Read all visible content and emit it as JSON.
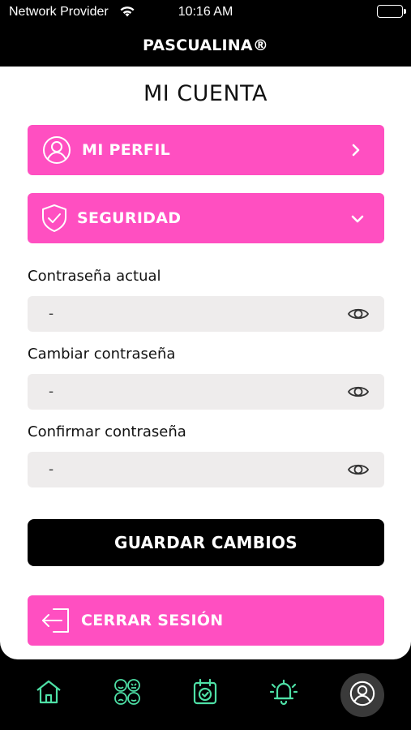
{
  "status_bar": {
    "carrier": "Network Provider",
    "time": "10:16 AM",
    "icons": [
      "wifi-icon",
      "battery-icon"
    ]
  },
  "header": {
    "title": "PASCUALINA®"
  },
  "page": {
    "title": "MI CUENTA"
  },
  "sections": {
    "profile": {
      "label": "MI PERFIL",
      "icon": "user-circle-icon",
      "chevron": "chevron-right-icon"
    },
    "security": {
      "label": "SEGURIDAD",
      "icon": "shield-check-icon",
      "chevron": "chevron-down-icon",
      "expanded": true
    }
  },
  "fields": [
    {
      "label": "Contraseña actual",
      "value": "-",
      "icon": "eye-icon"
    },
    {
      "label": "Cambiar contraseña",
      "value": "-",
      "icon": "eye-icon"
    },
    {
      "label": "Confirmar contraseña",
      "value": "-",
      "icon": "eye-icon"
    }
  ],
  "buttons": {
    "save": "GUARDAR CAMBIOS",
    "logout": {
      "label": "CERRAR SESIÓN",
      "icon": "logout-icon"
    }
  },
  "tab_bar": {
    "items": [
      {
        "icon": "home-icon",
        "active": false
      },
      {
        "icon": "moods-icon",
        "active": false
      },
      {
        "icon": "calendar-check-icon",
        "active": false
      },
      {
        "icon": "bell-alert-icon",
        "active": false
      },
      {
        "icon": "user-circle-icon",
        "active": true
      }
    ]
  },
  "colors": {
    "accent_pink": "#ff4fc1",
    "tab_icon_green": "#4ee0a6",
    "field_bg": "#eeecec",
    "background": "#000000",
    "card": "#ffffff"
  }
}
